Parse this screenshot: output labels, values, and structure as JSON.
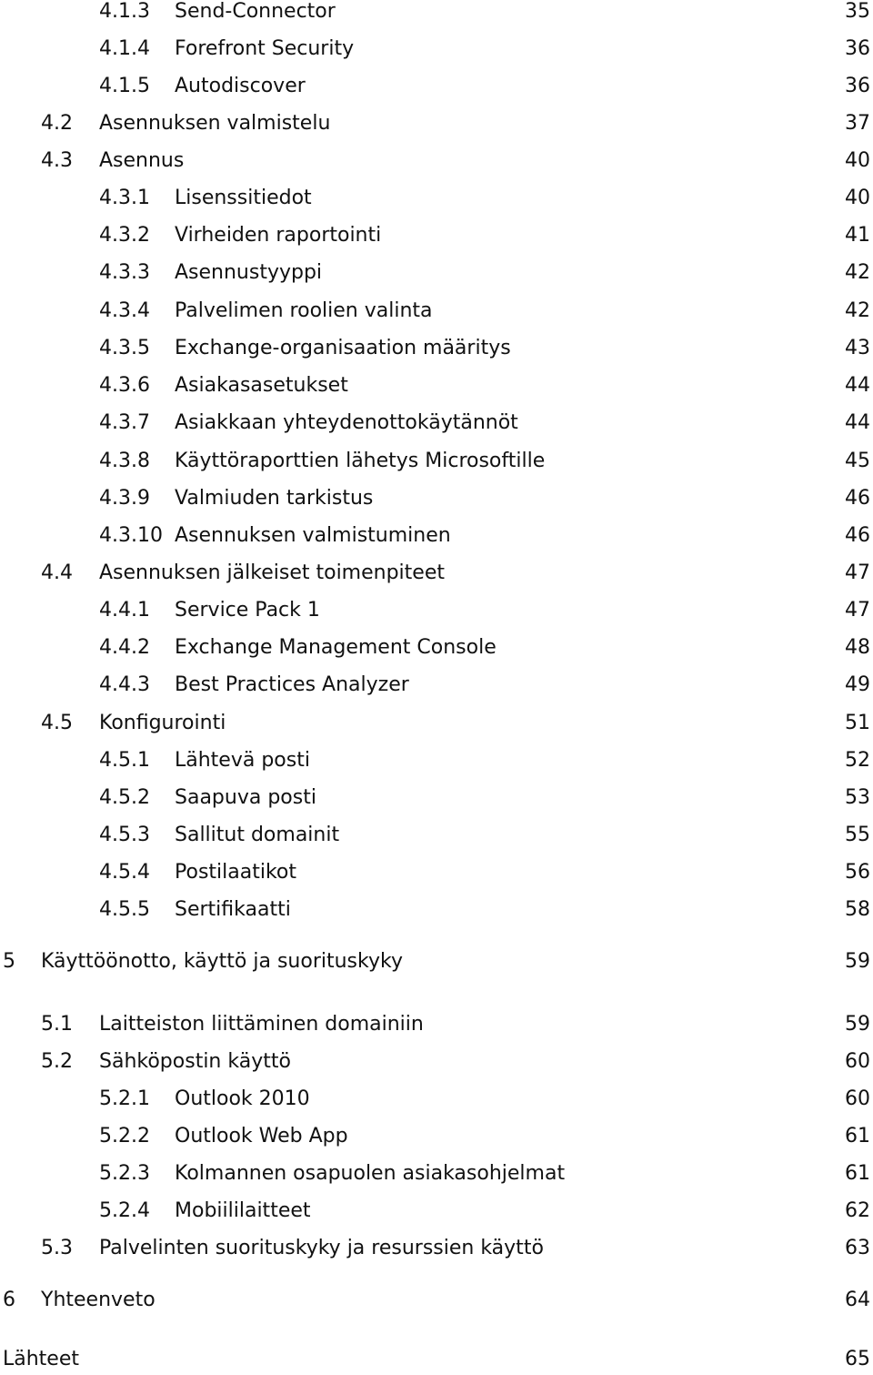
{
  "toc": {
    "entries": [
      {
        "level": 3,
        "number": "4.1.3",
        "title": "Send-Connector",
        "page": "35"
      },
      {
        "level": 3,
        "number": "4.1.4",
        "title": "Forefront Security",
        "page": "36"
      },
      {
        "level": 3,
        "number": "4.1.5",
        "title": "Autodiscover",
        "page": "36"
      },
      {
        "level": 2,
        "number": "4.2",
        "title": "Asennuksen valmistelu",
        "page": "37"
      },
      {
        "level": 2,
        "number": "4.3",
        "title": "Asennus",
        "page": "40"
      },
      {
        "level": 3,
        "number": "4.3.1",
        "title": "Lisenssitiedot",
        "page": "40"
      },
      {
        "level": 3,
        "number": "4.3.2",
        "title": "Virheiden raportointi",
        "page": "41"
      },
      {
        "level": 3,
        "number": "4.3.3",
        "title": "Asennustyyppi",
        "page": "42"
      },
      {
        "level": 3,
        "number": "4.3.4",
        "title": "Palvelimen roolien valinta",
        "page": "42"
      },
      {
        "level": 3,
        "number": "4.3.5",
        "title": "Exchange-organisaation määritys",
        "page": "43"
      },
      {
        "level": 3,
        "number": "4.3.6",
        "title": "Asiakasasetukset",
        "page": "44"
      },
      {
        "level": 3,
        "number": "4.3.7",
        "title": "Asiakkaan yhteydenottokäytännöt",
        "page": "44"
      },
      {
        "level": 3,
        "number": "4.3.8",
        "title": "Käyttöraporttien lähetys Microsoftille",
        "page": "45"
      },
      {
        "level": 3,
        "number": "4.3.9",
        "title": "Valmiuden tarkistus",
        "page": "46"
      },
      {
        "level": 3,
        "number": "4.3.10",
        "title": "Asennuksen valmistuminen",
        "page": "46"
      },
      {
        "level": 2,
        "number": "4.4",
        "title": "Asennuksen jälkeiset toimenpiteet",
        "page": "47"
      },
      {
        "level": 3,
        "number": "4.4.1",
        "title": "Service Pack 1",
        "page": "47"
      },
      {
        "level": 3,
        "number": "4.4.2",
        "title": "Exchange Management Console",
        "page": "48"
      },
      {
        "level": 3,
        "number": "4.4.3",
        "title": "Best Practices Analyzer",
        "page": "49"
      },
      {
        "level": 2,
        "number": "4.5",
        "title": "Konfigurointi",
        "page": "51"
      },
      {
        "level": 3,
        "number": "4.5.1",
        "title": "Lähtevä posti",
        "page": "52"
      },
      {
        "level": 3,
        "number": "4.5.2",
        "title": "Saapuva posti",
        "page": "53"
      },
      {
        "level": 3,
        "number": "4.5.3",
        "title": "Sallitut domainit",
        "page": "55"
      },
      {
        "level": 3,
        "number": "4.5.4",
        "title": "Postilaatikot",
        "page": "56"
      },
      {
        "level": 3,
        "number": "4.5.5",
        "title": "Sertifikaatti",
        "page": "58"
      },
      {
        "level": 1,
        "number": "5",
        "title": "Käyttöönotto, käyttö ja suorituskyky",
        "page": "59"
      },
      {
        "level": 2,
        "number": "5.1",
        "title": "Laitteiston liittäminen domainiin",
        "page": "59"
      },
      {
        "level": 2,
        "number": "5.2",
        "title": "Sähköpostin käyttö",
        "page": "60"
      },
      {
        "level": 3,
        "number": "5.2.1",
        "title": "Outlook 2010",
        "page": "60"
      },
      {
        "level": 3,
        "number": "5.2.2",
        "title": "Outlook Web App",
        "page": "61"
      },
      {
        "level": 3,
        "number": "5.2.3",
        "title": "Kolmannen osapuolen asiakasohjelmat",
        "page": "61"
      },
      {
        "level": 3,
        "number": "5.2.4",
        "title": "Mobiililaitteet",
        "page": "62"
      },
      {
        "level": 2,
        "number": "5.3",
        "title": "Palvelinten suorituskyky ja resurssien käyttö",
        "page": "63"
      },
      {
        "level": 1,
        "number": "6",
        "title": "Yhteenveto",
        "page": "64"
      },
      {
        "level": 0,
        "number": "",
        "title": "Lähteet",
        "page": "65"
      }
    ]
  }
}
